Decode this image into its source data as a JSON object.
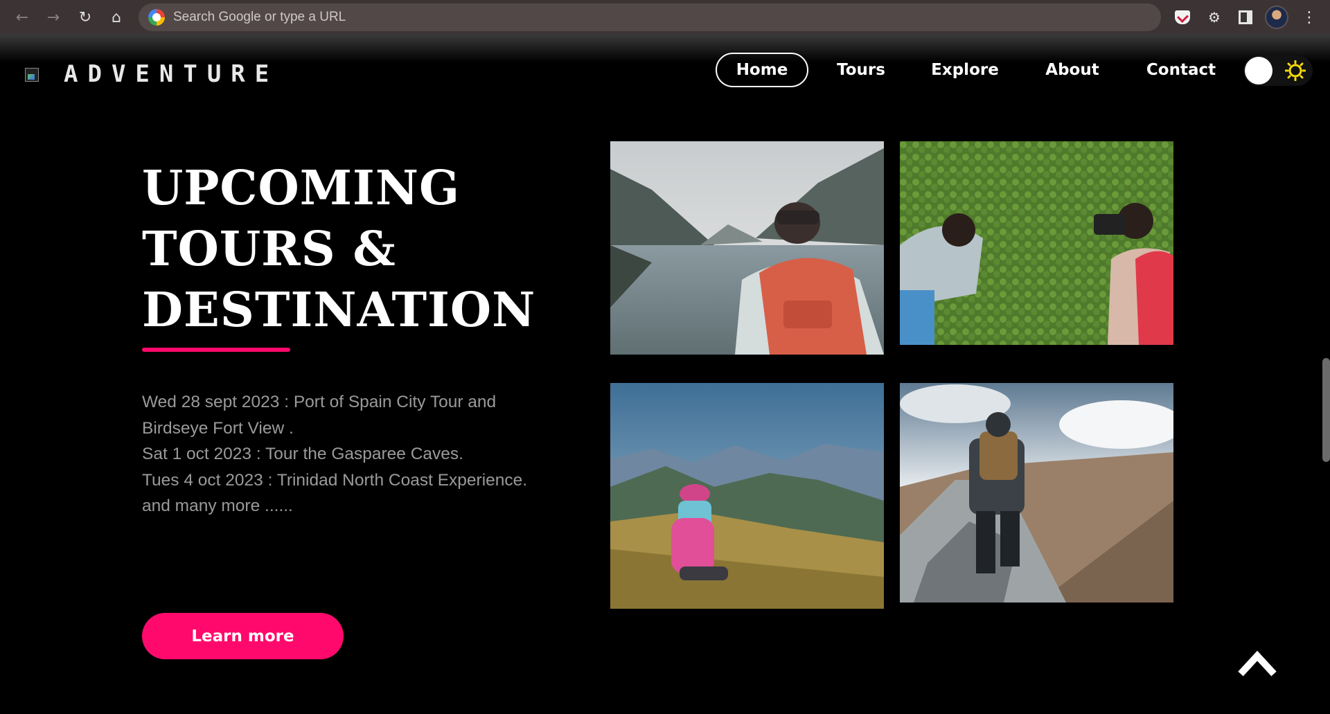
{
  "browser": {
    "omnibox_placeholder": "Search Google or type a URL",
    "icons": [
      "back-arrow-icon",
      "forward-arrow-icon",
      "reload-icon",
      "home-icon",
      "google-icon",
      "pocket-icon",
      "puzzle-icon",
      "side-panel-icon",
      "profile-avatar",
      "kebab-menu-icon"
    ]
  },
  "header": {
    "brand": "ADVENTURE",
    "nav": {
      "home": "Home",
      "tours": "Tours",
      "explore": "Explore",
      "about": "About",
      "contact": "Contact"
    },
    "active_nav": "Home"
  },
  "hero": {
    "title_lines": [
      "UPCOMING",
      "TOURS &",
      "DESTINATION"
    ],
    "tours": [
      "Wed 28 sept 2023 : Port of Spain City Tour and Birdseye Fort View .",
      "Sat 1 oct 2023 : Tour the Gasparee Caves.",
      "Tues 4 oct 2023 : Trinidad North Coast Experience.",
      "and many more ......"
    ],
    "button_label": "Learn more"
  },
  "colors": {
    "accent": "#ff0a6c",
    "background": "#000000",
    "text_muted": "#9a9a9a",
    "sun": "#f5d90a"
  }
}
